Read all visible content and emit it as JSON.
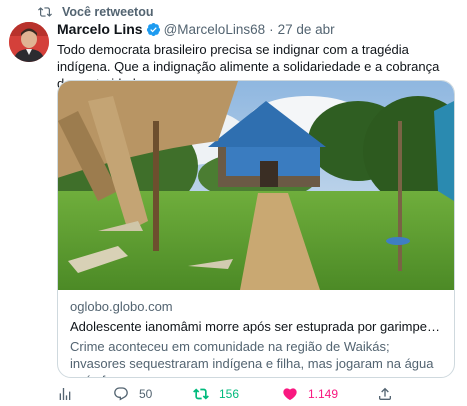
{
  "retweet_context": {
    "label": "Você retweetou",
    "icon": "retweet-icon"
  },
  "author": {
    "name": "Marcelo Lins",
    "handle": "@MarceloLins68",
    "separator": "·",
    "date": "27 de abr",
    "verified": true
  },
  "tweet": {
    "text": "Todo democrata brasileiro precisa se indignar com a tragédia indígena. Que a indignação alimente a solidariedade e a cobrança das autoridades."
  },
  "link_card": {
    "domain": "oglobo.globo.com",
    "title": "Adolescente ianomâmi morre após ser estuprada por garimpeiros; cria…",
    "description": "Crime aconteceu em comunidade na região de Waikás; invasores sequestraram indígena e filha, mas jogaram na água após fuga"
  },
  "actions": {
    "analytics": {
      "icon": "bar-chart-icon"
    },
    "reply": {
      "icon": "reply-icon",
      "count": "50"
    },
    "retweet": {
      "icon": "retweet-icon",
      "count": "156",
      "active": true
    },
    "like": {
      "icon": "heart-icon",
      "count": "1.149",
      "active": true
    },
    "share": {
      "icon": "share-icon"
    }
  },
  "colors": {
    "text": "#0f1419",
    "secondary": "#536471",
    "verified": "#1d9bf0",
    "retweet": "#00ba7c",
    "like": "#f91880",
    "border": "#cfd9de"
  }
}
